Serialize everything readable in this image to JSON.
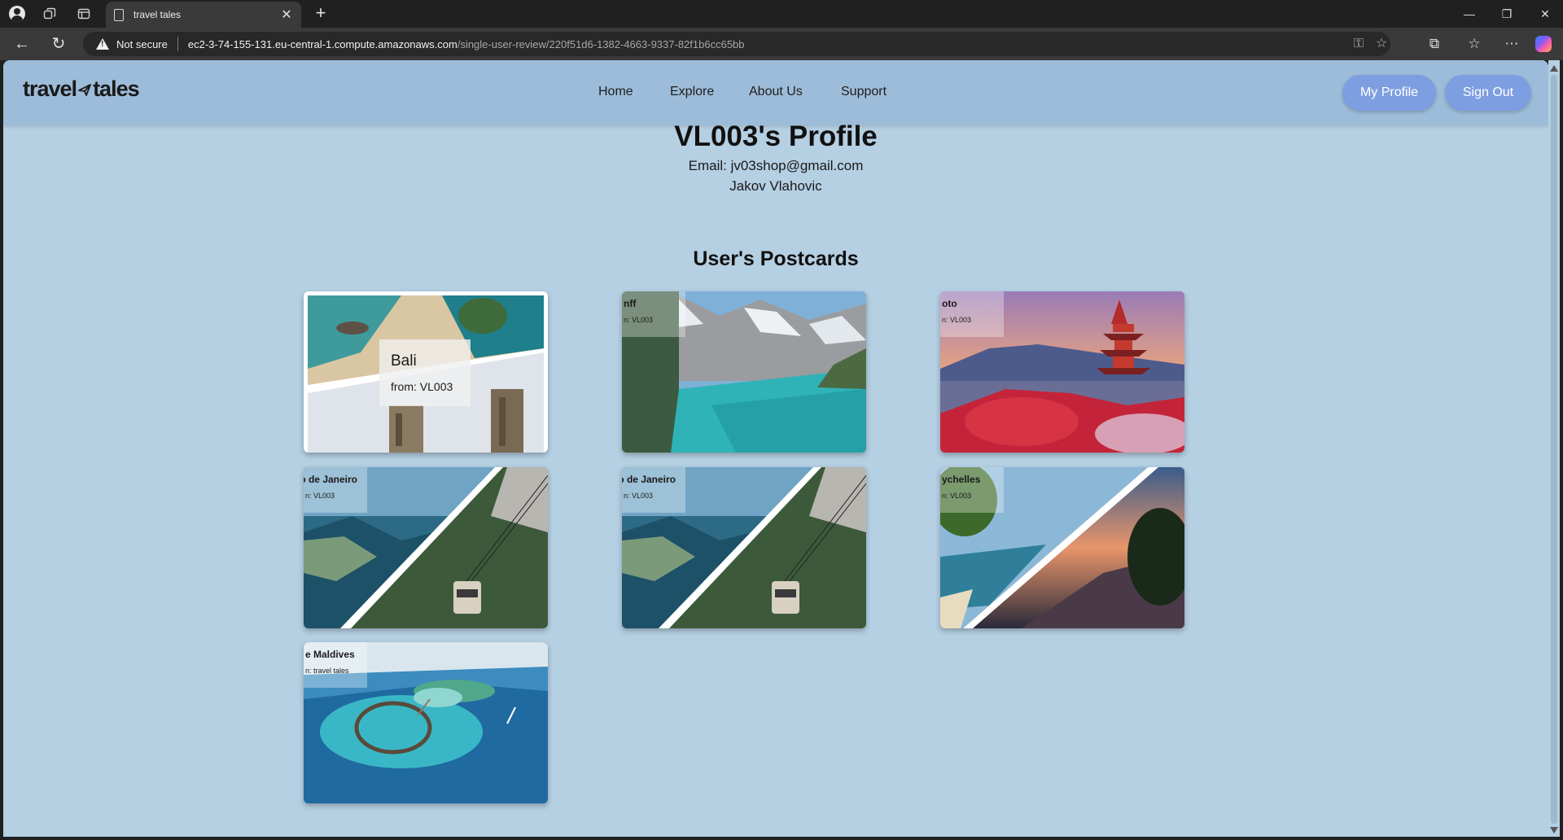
{
  "browser": {
    "tab_title": "travel tales",
    "not_secure": "Not secure",
    "url_host": "ec2-3-74-155-131.eu-central-1.compute.amazonaws.com",
    "url_path": "/single-user-review/220f51d6-1382-4663-9337-82f1b6cc65bb"
  },
  "site": {
    "logo_left": "travel",
    "logo_right": "tales",
    "nav": [
      "Home",
      "Explore",
      "About Us",
      "Support"
    ],
    "my_profile": "My Profile",
    "sign_out": "Sign Out"
  },
  "profile": {
    "title": "VL003's Profile",
    "email": "Email: jv03shop@gmail.com",
    "name": "Jakov Vlahovic"
  },
  "postcards_title": "User's Postcards",
  "postcards": [
    {
      "place": "Bali",
      "from": "from: VL003"
    },
    {
      "place": "nff",
      "from": "n: VL003"
    },
    {
      "place": "oto",
      "from": "n: VL003"
    },
    {
      "place": "o de Janeiro",
      "from": "n: VL003"
    },
    {
      "place": "o de Janeiro",
      "from": "n: VL003"
    },
    {
      "place": "ychelles",
      "from": "n: VL003"
    },
    {
      "place": "e Maldives",
      "from": "n: travel tales"
    }
  ],
  "colors": {
    "page_bg": "#b5cfe3",
    "header_bg": "#9dbcd9",
    "button_bg": "#7e9ee2"
  }
}
